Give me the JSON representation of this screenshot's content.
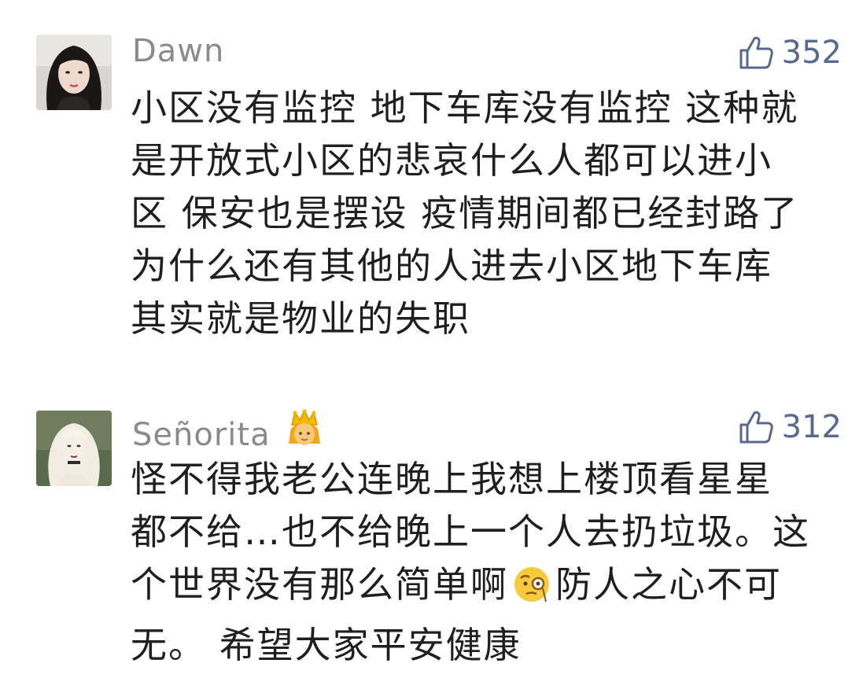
{
  "comments": [
    {
      "username": "Dawn",
      "likes": "352",
      "content_lines": [
        "小区没有监控 地下车库没有监控 这种就",
        "是开放式小区的悲哀什么人都可以进小",
        "区 保安也是摆设 疫情期间都已经封路了",
        "为什么还有其他的人进去小区地下车库",
        "其实就是物业的失职"
      ]
    },
    {
      "username": "Señorita",
      "username_emoji": "princess-emoji",
      "likes": "312",
      "content_lines": [
        "怪不得我老公连晚上我想上楼顶看星星",
        "都不给…也不给晚上一个人去扔垃圾。这",
        "个世界没有那么简单啊",
        "防人之心不可",
        "无。 希望大家平安健康"
      ],
      "inline_emoji": "monocle-face-emoji"
    }
  ],
  "icons": {
    "like": "thumbs-up-icon"
  },
  "colors": {
    "username": "#8a8a8a",
    "likes": "#57698f",
    "text": "#1f1f1f",
    "background": "#ffffff"
  }
}
